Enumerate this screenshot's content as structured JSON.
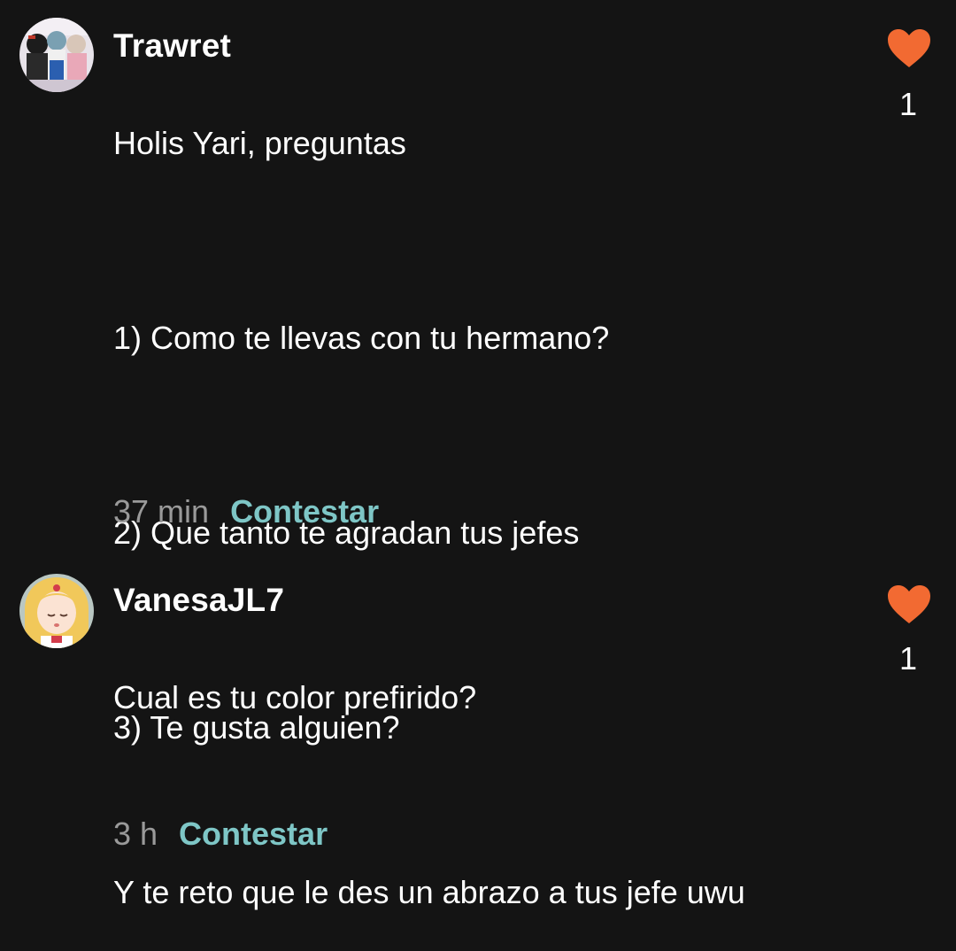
{
  "colors": {
    "background": "#141414",
    "text": "#ffffff",
    "timestamp": "#9a9a9a",
    "reply_link": "#7ec6c6",
    "like_heart": "#f26a32"
  },
  "comments": [
    {
      "username": "Trawret",
      "avatar_icon": "avatar-group-illustration",
      "lines": [
        "Holis Yari, preguntas",
        "1) Como te llevas con tu hermano?",
        "2) Que tanto te agradan tus jefes",
        "3) Te gusta alguien?"
      ],
      "time": "37 min",
      "reply_label": "Contestar",
      "like_icon": "heart-icon",
      "like_count": "1"
    },
    {
      "username": "VanesaJL7",
      "avatar_icon": "avatar-anime-girl",
      "lines": [
        "Cual es tu color prefirido?",
        "Y te reto que le des un abrazo a tus jefe uwu"
      ],
      "time": "3 h",
      "reply_label": "Contestar",
      "like_icon": "heart-icon",
      "like_count": "1"
    }
  ]
}
